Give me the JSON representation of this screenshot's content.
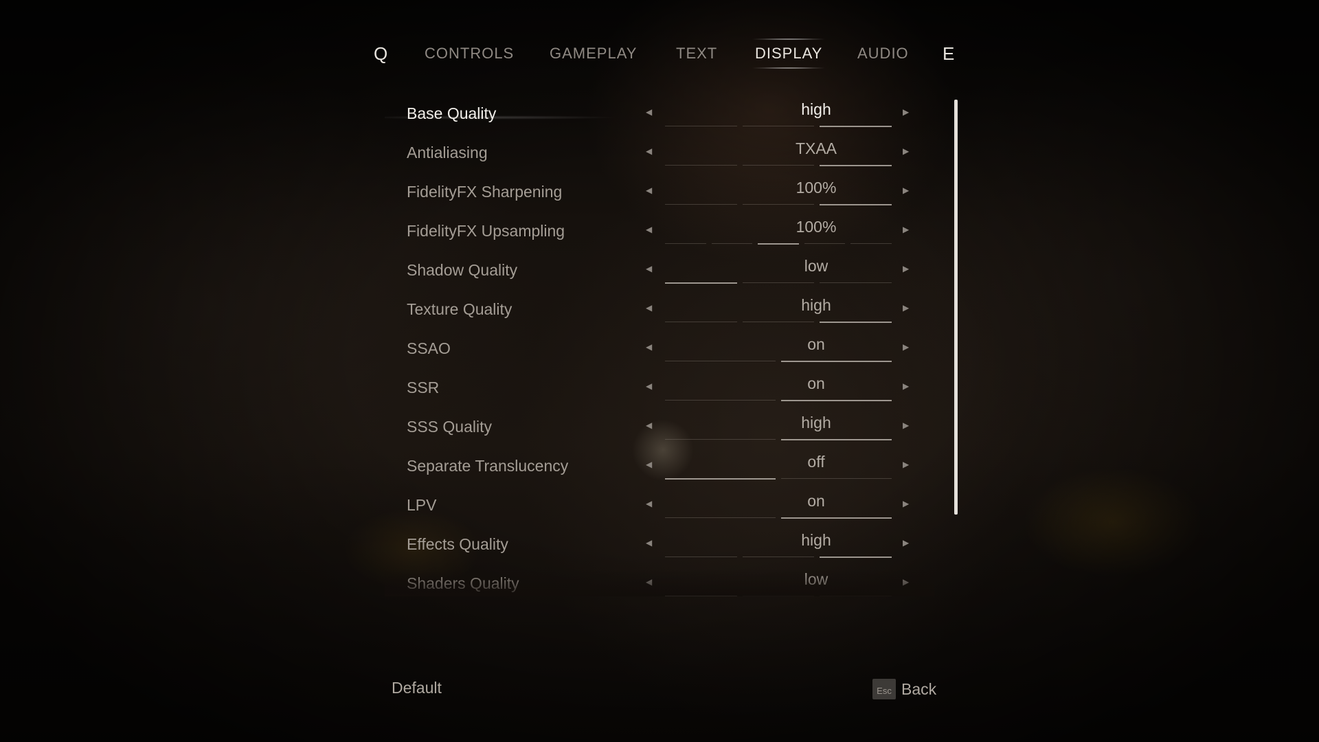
{
  "tabs": {
    "prev_key": "Q",
    "next_key": "E",
    "items": [
      {
        "label": "CONTROLS"
      },
      {
        "label": "GAMEPLAY"
      },
      {
        "label": "TEXT"
      },
      {
        "label": "DISPLAY",
        "active": true
      },
      {
        "label": "AUDIO"
      }
    ]
  },
  "settings": [
    {
      "label": "Base Quality",
      "value": "high",
      "selected": true,
      "level_index": 2,
      "level_count": 3
    },
    {
      "label": "Antialiasing",
      "value": "TXAA",
      "level_index": 2,
      "level_count": 3
    },
    {
      "label": "FidelityFX Sharpening",
      "value": "100%",
      "level_index": 2,
      "level_count": 3
    },
    {
      "label": "FidelityFX Upsampling",
      "value": "100%",
      "level_index": 2,
      "level_count": 5
    },
    {
      "label": "Shadow Quality",
      "value": "low",
      "level_index": 0,
      "level_count": 3
    },
    {
      "label": "Texture Quality",
      "value": "high",
      "level_index": 2,
      "level_count": 3
    },
    {
      "label": "SSAO",
      "value": "on",
      "level_index": 1,
      "level_count": 2
    },
    {
      "label": "SSR",
      "value": "on",
      "level_index": 1,
      "level_count": 2
    },
    {
      "label": "SSS Quality",
      "value": "high",
      "level_index": 1,
      "level_count": 2
    },
    {
      "label": "Separate Translucency",
      "value": "off",
      "level_index": 0,
      "level_count": 2
    },
    {
      "label": "LPV",
      "value": "on",
      "level_index": 1,
      "level_count": 2
    },
    {
      "label": "Effects Quality",
      "value": "high",
      "level_index": 2,
      "level_count": 3
    },
    {
      "label": "Shaders Quality",
      "value": "low",
      "level_index": 0,
      "level_count": 3
    }
  ],
  "footer": {
    "default_label": "Default",
    "esc_key": "Esc",
    "back_label": "Back"
  },
  "colors": {
    "active_text": "#f2efea",
    "inactive_text": "#a49d95",
    "background": "#120d0a"
  },
  "icons": {
    "left_arrow": "left-arrow-icon",
    "right_arrow": "right-arrow-icon"
  }
}
